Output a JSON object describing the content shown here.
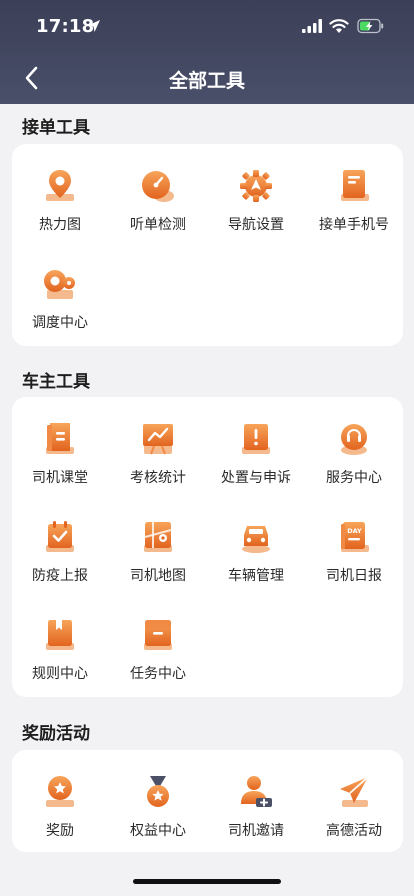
{
  "status_bar": {
    "time": "17:18"
  },
  "nav": {
    "title": "全部工具"
  },
  "sections": [
    {
      "title": "接单工具",
      "items": [
        {
          "label": "热力图",
          "icon": "map-pin-icon"
        },
        {
          "label": "听单检测",
          "icon": "gauge-icon"
        },
        {
          "label": "导航设置",
          "icon": "gear-navigation-icon"
        },
        {
          "label": "接单手机号",
          "icon": "phone-book-icon"
        },
        {
          "label": "调度中心",
          "icon": "dispatch-wheel-icon"
        }
      ]
    },
    {
      "title": "车主工具",
      "items": [
        {
          "label": "司机课堂",
          "icon": "book-icon"
        },
        {
          "label": "考核统计",
          "icon": "chart-board-icon"
        },
        {
          "label": "处置与申诉",
          "icon": "alert-box-icon"
        },
        {
          "label": "服务中心",
          "icon": "headset-icon"
        },
        {
          "label": "防疫上报",
          "icon": "calendar-check-icon"
        },
        {
          "label": "司机地图",
          "icon": "map-icon"
        },
        {
          "label": "车辆管理",
          "icon": "car-icon"
        },
        {
          "label": "司机日报",
          "icon": "day-report-icon"
        },
        {
          "label": "规则中心",
          "icon": "rule-book-icon"
        },
        {
          "label": "任务中心",
          "icon": "task-box-icon"
        }
      ]
    },
    {
      "title": "奖励活动",
      "items": [
        {
          "label": "奖励",
          "icon": "award-badge-icon"
        },
        {
          "label": "权益中心",
          "icon": "medal-icon"
        },
        {
          "label": "司机邀请",
          "icon": "invite-user-icon"
        },
        {
          "label": "高德活动",
          "icon": "paper-plane-icon"
        }
      ]
    }
  ],
  "colors": {
    "accent": "#e8742c",
    "accent_light": "#f5a35f",
    "header": "#42465f",
    "background": "#f2f2f4"
  }
}
